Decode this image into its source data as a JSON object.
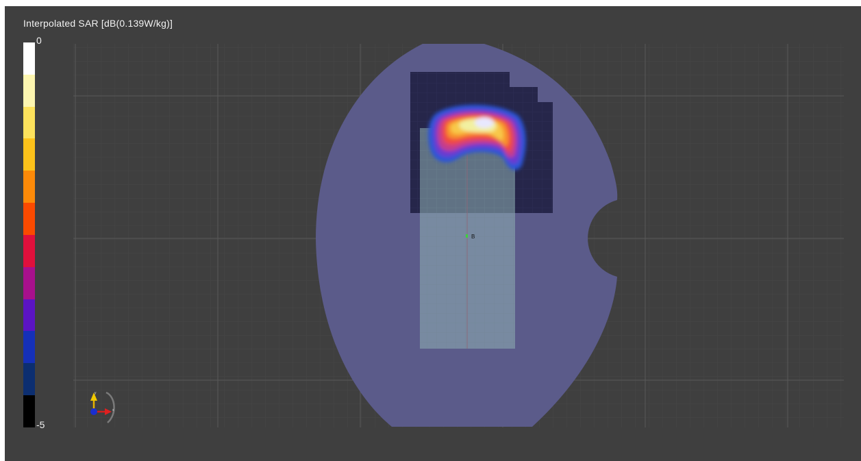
{
  "legend": {
    "title": "Interpolated SAR [dB(0.139W/kg)]",
    "max_label": "0",
    "min_label": "-5",
    "colors": [
      "#ffffff",
      "#fdf6b0",
      "#fde25c",
      "#fdc21a",
      "#fd8a08",
      "#fb4a00",
      "#e0103c",
      "#a8108c",
      "#5b14c4",
      "#1530b8",
      "#0c2e70",
      "#000000"
    ]
  },
  "viewport": {
    "background": "#3f3f3f",
    "phantom_color": "#5b5b8a",
    "marker_label": "B"
  }
}
